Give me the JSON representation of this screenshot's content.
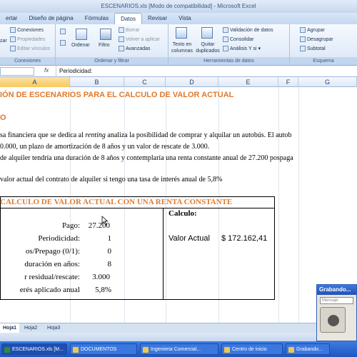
{
  "window": {
    "title": "ESCENARIOS.xls  [Modo de compatibilidad] - Microsoft Excel"
  },
  "ribbon_tabs": [
    "ertar",
    "Diseño de página",
    "Fórmulas",
    "Datos",
    "Revisar",
    "Vista"
  ],
  "ribbon": {
    "conexiones": {
      "connections": "Conexiones",
      "properties": "Propiedades",
      "edit_links": "Editar vínculos",
      "refresh_partial": "zar",
      "label": "Conexiones"
    },
    "sort_filter": {
      "sort": "Ordenar",
      "filter": "Filtro",
      "clear": "Borrar",
      "reapply": "Volver a aplicar",
      "advanced": "Avanzadas",
      "label": "Ordenar y filtrar"
    },
    "data_tools": {
      "text_to_columns": "Texto en columnas",
      "remove_duplicates": "Quitar duplicados",
      "validation": "Validación de datos",
      "consolidate": "Consolidar",
      "what_if": "Análisis Y si",
      "label": "Herramientas de datos"
    },
    "outline": {
      "group": "Agrupar",
      "ungroup": "Desagrupar",
      "subtotal": "Subtotal",
      "label": "Esquema"
    }
  },
  "formula_bar": {
    "name_box": "",
    "fx": "fx",
    "content": "Periodicidad:"
  },
  "columns": [
    "A",
    "B",
    "C",
    "D",
    "E",
    "F",
    "G"
  ],
  "sheet": {
    "title": "IÓN DE ESCENARIOS PARA EL CALCULO DE VALOR ACTUAL",
    "section_letter": "O",
    "para1_a": "sa financiera que se dedica al ",
    "para1_italic": "renting",
    "para1_b": "  analiza la posibilidad de comprar y alquilar un autobús. El autob",
    "para2": "0.000, un plazo de amortización de 8 años y un valor de rescate de 3.000.",
    "para3": "de alquiler tendría una duración de 8 años y contemplaría una renta constante anual de 27.200 pospaga",
    "para4": "valor actual del contrato de alquiler si tengo una tasa de interés anual de 5,8%",
    "box_title": "CALCULO DE VALOR ACTUAL CON UNA RENTA CONSTANTE",
    "calc_label": "Calculo:",
    "rows": [
      {
        "label": "Pago:",
        "value": "27.200"
      },
      {
        "label": "Periodicidad:",
        "value": "1"
      },
      {
        "label": "os/Prepago (0/1):",
        "value": "0"
      },
      {
        "label": "duración en años:",
        "value": "8"
      },
      {
        "label": "r residual/rescate:",
        "value": "3.000"
      },
      {
        "label": "erés aplicado anual",
        "value": "5,8%"
      }
    ],
    "result_label": "Valor Actual",
    "result_value": "$ 172.162,41"
  },
  "sheet_tabs": [
    "Hoja1",
    "Hoja2",
    "Hoja3"
  ],
  "taskbar": [
    "ESCENARIOS.xls [M...",
    "DOCUMENTOS",
    "Ingenieria Comercial...",
    "Centro de inicio",
    "Grabando..."
  ],
  "recorder": {
    "title": "Grabando...",
    "dropdown": "Mensaje"
  }
}
